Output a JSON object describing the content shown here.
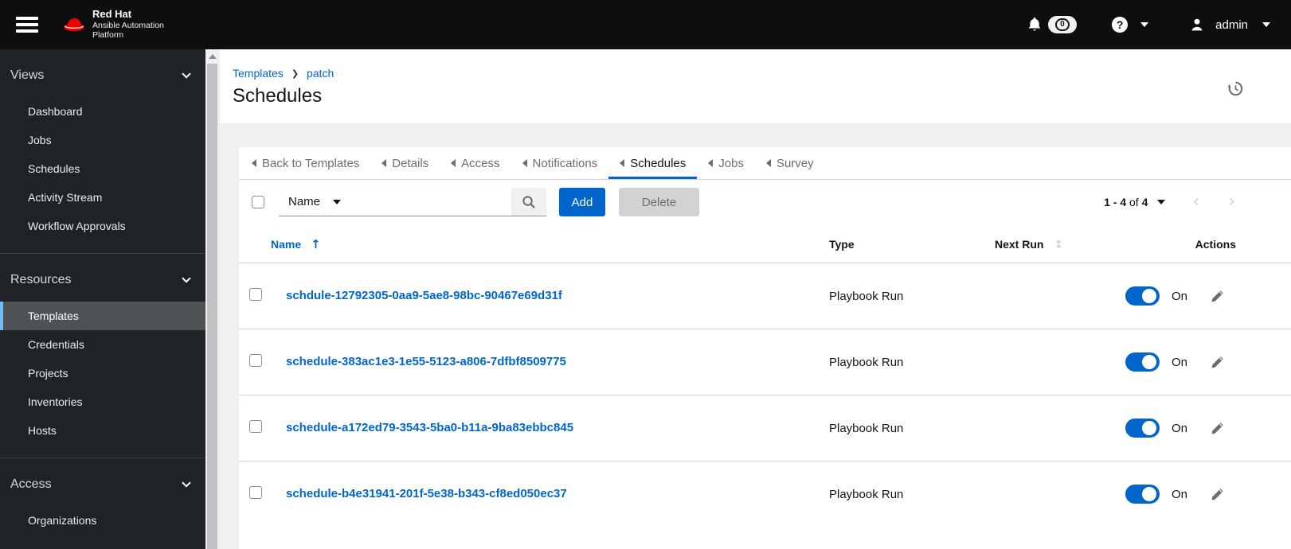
{
  "masthead": {
    "brand_line1": "Red Hat",
    "brand_line2": "Ansible Automation",
    "brand_line3": "Platform",
    "notification_count": "0",
    "user": "admin"
  },
  "sidebar": {
    "groups": [
      {
        "label": "Views",
        "items": [
          {
            "label": "Dashboard"
          },
          {
            "label": "Jobs"
          },
          {
            "label": "Schedules"
          },
          {
            "label": "Activity Stream"
          },
          {
            "label": "Workflow Approvals"
          }
        ]
      },
      {
        "label": "Resources",
        "items": [
          {
            "label": "Templates",
            "selected": true
          },
          {
            "label": "Credentials"
          },
          {
            "label": "Projects"
          },
          {
            "label": "Inventories"
          },
          {
            "label": "Hosts"
          }
        ]
      },
      {
        "label": "Access",
        "items": [
          {
            "label": "Organizations"
          }
        ]
      }
    ]
  },
  "page": {
    "breadcrumb": [
      "Templates",
      "patch"
    ],
    "title": "Schedules"
  },
  "tabs": [
    {
      "label": "Back to Templates",
      "back": true
    },
    {
      "label": "Details"
    },
    {
      "label": "Access"
    },
    {
      "label": "Notifications"
    },
    {
      "label": "Schedules",
      "active": true
    },
    {
      "label": "Jobs"
    },
    {
      "label": "Survey"
    }
  ],
  "toolbar": {
    "filter_label": "Name",
    "search_value": "",
    "add_label": "Add",
    "delete_label": "Delete",
    "pagination": {
      "range": "1 - 4",
      "of_label": "of",
      "total": "4"
    }
  },
  "table": {
    "headers": {
      "name": "Name",
      "type": "Type",
      "next_run": "Next Run",
      "actions": "Actions"
    },
    "sort_asc_icon": "↑",
    "sort_both_icon": "↕",
    "rows": [
      {
        "name": "schdule-12792305-0aa9-5ae8-98bc-90467e69d31f",
        "type": "Playbook Run",
        "toggle": "On"
      },
      {
        "name": "schedule-383ac1e3-1e55-5123-a806-7dfbf8509775",
        "type": "Playbook Run",
        "toggle": "On"
      },
      {
        "name": "schedule-a172ed79-3543-5ba0-b11a-9ba83ebbc845",
        "type": "Playbook Run",
        "toggle": "On"
      },
      {
        "name": "schedule-b4e31941-201f-5e38-b343-cf8ed050ec37",
        "type": "Playbook Run",
        "toggle": "On"
      }
    ]
  },
  "colors": {
    "accent_blue": "#0066cc",
    "link_blue": "#0066cc",
    "masthead_bg": "#0d0e10",
    "sidebar_bg": "#1f2226",
    "selected_item_bg": "#4f5255",
    "selected_item_accent": "#73bcf7",
    "brand_red": "#ee0000",
    "muted_text": "#6a6e73",
    "border_gray": "#d2d2d2",
    "page_bg": "#f0f0f0",
    "toggle_on": "#0066cc"
  }
}
